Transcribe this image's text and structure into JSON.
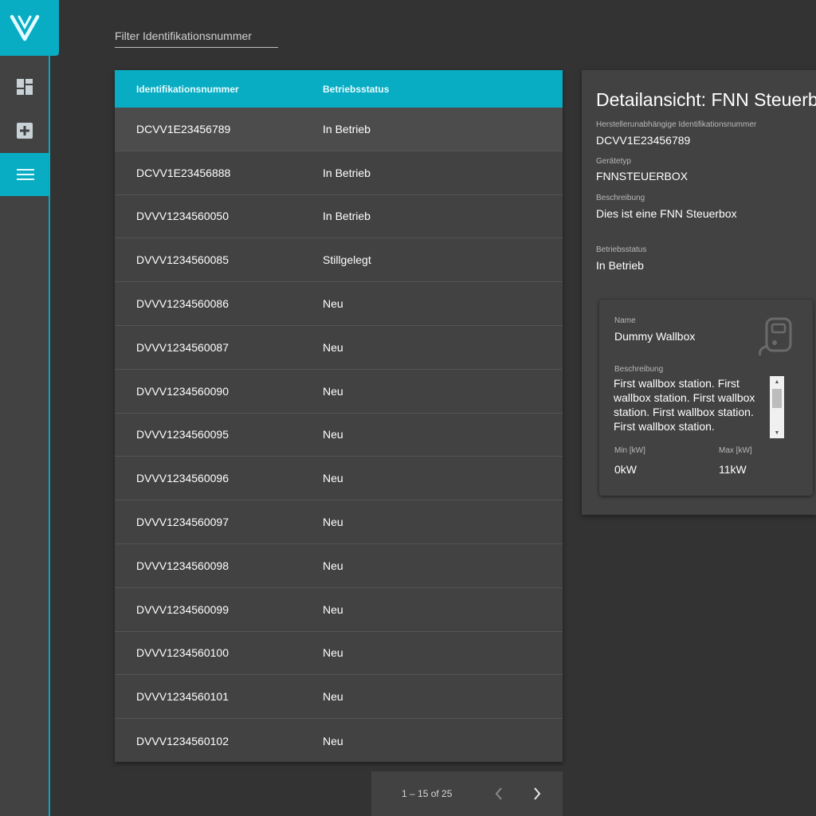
{
  "sidebar": {
    "logo": "v-logo-icon",
    "items": [
      {
        "icon": "dashboard-icon"
      },
      {
        "icon": "add-box-icon"
      },
      {
        "icon": "list-menu-icon",
        "active": true
      }
    ]
  },
  "filter": {
    "placeholder": "Filter Identifikationsnummer"
  },
  "table": {
    "headers": {
      "id": "Identifikationsnummer",
      "status": "Betriebsstatus"
    },
    "rows": [
      {
        "id": "DCVV1E23456789",
        "status": "In Betrieb"
      },
      {
        "id": "DCVV1E23456888",
        "status": "In Betrieb"
      },
      {
        "id": "DVVV1234560050",
        "status": "In Betrieb"
      },
      {
        "id": "DVVV1234560085",
        "status": "Stillgelegt"
      },
      {
        "id": "DVVV1234560086",
        "status": "Neu"
      },
      {
        "id": "DVVV1234560087",
        "status": "Neu"
      },
      {
        "id": "DVVV1234560090",
        "status": "Neu"
      },
      {
        "id": "DVVV1234560095",
        "status": "Neu"
      },
      {
        "id": "DVVV1234560096",
        "status": "Neu"
      },
      {
        "id": "DVVV1234560097",
        "status": "Neu"
      },
      {
        "id": "DVVV1234560098",
        "status": "Neu"
      },
      {
        "id": "DVVV1234560099",
        "status": "Neu"
      },
      {
        "id": "DVVV1234560100",
        "status": "Neu"
      },
      {
        "id": "DVVV1234560101",
        "status": "Neu"
      },
      {
        "id": "DVVV1234560102",
        "status": "Neu"
      }
    ]
  },
  "paginator": {
    "range": "1 – 15 of 25"
  },
  "detail": {
    "title": "Detailansicht: FNN Steuerbox",
    "id_label": "Herstellerunabhängige Identifikationsnummer",
    "id_value": "DCVV1E23456789",
    "type_label": "Gerätetyp",
    "type_value": "FNNSTEUERBOX",
    "desc_label": "Beschreibung",
    "desc_value": "Dies ist eine FNN Steuerbox",
    "status_label": "Betriebsstatus",
    "status_value": "In Betrieb",
    "device": {
      "name_label": "Name",
      "name_value": "Dummy Wallbox",
      "desc_label": "Beschreibung",
      "desc_value": "First wallbox station. First wallbox station. First wallbox station. First wallbox station. First wallbox station.",
      "min_label": "Min [kW]",
      "min_value": "0kW",
      "max_label": "Max [kW]",
      "max_value": "11kW",
      "icon": "wallbox-icon"
    }
  },
  "colors": {
    "accent": "#08adc3",
    "background": "#333333",
    "surface": "#424242"
  }
}
